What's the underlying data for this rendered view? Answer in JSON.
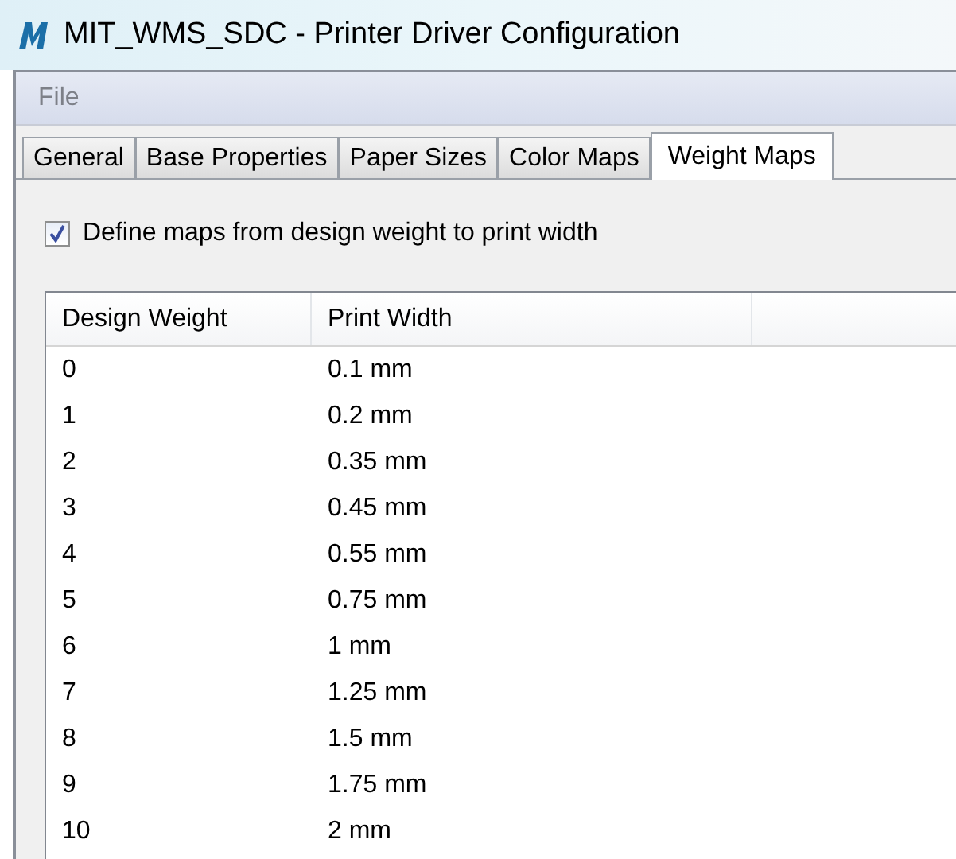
{
  "window": {
    "title": "MIT_WMS_SDC - Printer Driver Configuration"
  },
  "menu": [
    "File"
  ],
  "tabs": [
    {
      "label": "General",
      "selected": false
    },
    {
      "label": "Base Properties",
      "selected": false
    },
    {
      "label": "Paper Sizes",
      "selected": false
    },
    {
      "label": "Color Maps",
      "selected": false
    },
    {
      "label": "Weight Maps",
      "selected": true
    }
  ],
  "define_maps": {
    "label": "Define maps from design weight to print width",
    "checked": true
  },
  "table": {
    "columns": [
      "Design Weight",
      "Print Width"
    ],
    "rows": [
      [
        "0",
        "0.1 mm"
      ],
      [
        "1",
        "0.2 mm"
      ],
      [
        "2",
        "0.35 mm"
      ],
      [
        "3",
        "0.45 mm"
      ],
      [
        "4",
        "0.55 mm"
      ],
      [
        "5",
        "0.75 mm"
      ],
      [
        "6",
        "1 mm"
      ],
      [
        "7",
        "1.25 mm"
      ],
      [
        "8",
        "1.5 mm"
      ],
      [
        "9",
        "1.75 mm"
      ],
      [
        "10",
        "2 mm"
      ]
    ]
  }
}
